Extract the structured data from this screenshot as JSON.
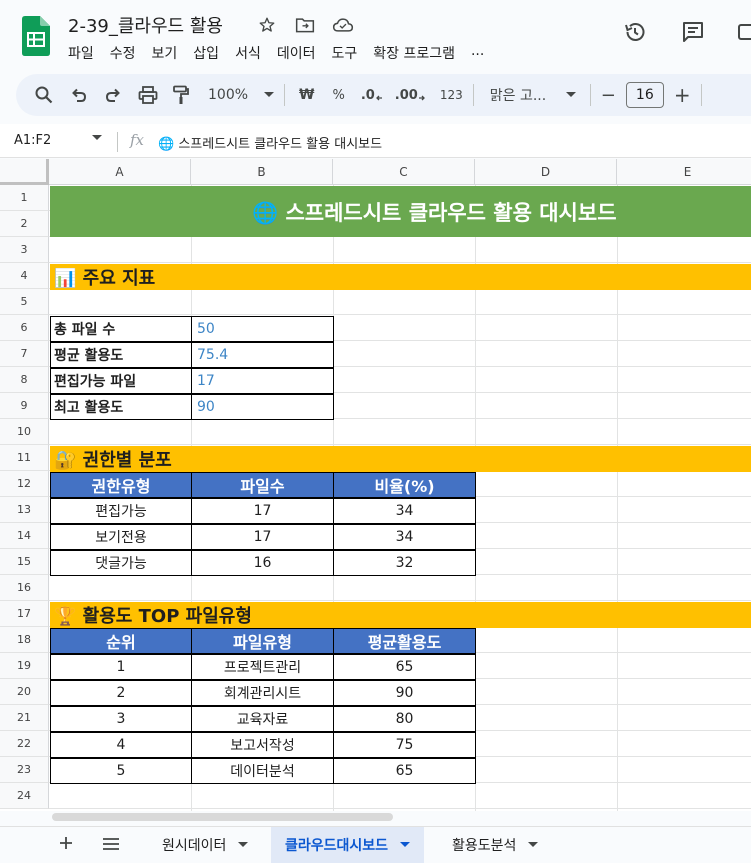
{
  "app": {
    "title": "2-39_클라우드 활용",
    "menu": [
      "파일",
      "수정",
      "보기",
      "삽입",
      "서식",
      "데이터",
      "도구",
      "확장 프로그램",
      "..."
    ]
  },
  "toolbar": {
    "zoom": "100%",
    "currency": "₩",
    "percent": "%",
    "dec_decrease": ".0",
    "dec_increase": ".00",
    "number_format": "123",
    "font": "맑은 고...",
    "font_size": "16",
    "minus": "−",
    "plus": "+"
  },
  "formula_bar": {
    "name_box": "A1:F2",
    "fx": "fx",
    "formula": "🌐 스프레드시트 클라우드 활용 대시보드"
  },
  "columns": [
    "A",
    "B",
    "C",
    "D",
    "E"
  ],
  "rows": [
    "1",
    "2",
    "3",
    "4",
    "5",
    "6",
    "7",
    "8",
    "9",
    "10",
    "11",
    "12",
    "13",
    "14",
    "15",
    "16",
    "17",
    "18",
    "19",
    "20",
    "21",
    "22",
    "23",
    "24"
  ],
  "sheet": {
    "banner": "🌐 스프레드시트 클라우드 활용 대시보드",
    "kpi_section": "📊 주요 지표",
    "kpis": [
      {
        "label": "총 파일 수",
        "value": "50"
      },
      {
        "label": "평균 활용도",
        "value": "75.4"
      },
      {
        "label": "편집가능 파일",
        "value": "17"
      },
      {
        "label": "최고 활용도",
        "value": "90"
      }
    ],
    "perm_section": "🔐 권한별 분포",
    "perm_headers": [
      "권한유형",
      "파일수",
      "비율(%)"
    ],
    "perm_rows": [
      [
        "편집가능",
        "17",
        "34"
      ],
      [
        "보기전용",
        "17",
        "34"
      ],
      [
        "댓글가능",
        "16",
        "32"
      ]
    ],
    "top_section": "🏆 활용도 TOP 파일유형",
    "top_headers": [
      "순위",
      "파일유형",
      "평균활용도"
    ],
    "top_rows": [
      [
        "1",
        "프로젝트관리",
        "65"
      ],
      [
        "2",
        "회계관리시트",
        "90"
      ],
      [
        "3",
        "교육자료",
        "80"
      ],
      [
        "4",
        "보고서작성",
        "75"
      ],
      [
        "5",
        "데이터분석",
        "65"
      ]
    ]
  },
  "sheets": [
    "원시데이터",
    "클라우드대시보드",
    "활용도분석"
  ],
  "colors": {
    "banner": "#6aa84f",
    "section": "#ffc000",
    "table_header": "#4472c4",
    "kpi_value": "#3d85c6",
    "active_tab": "#0b57d0"
  }
}
